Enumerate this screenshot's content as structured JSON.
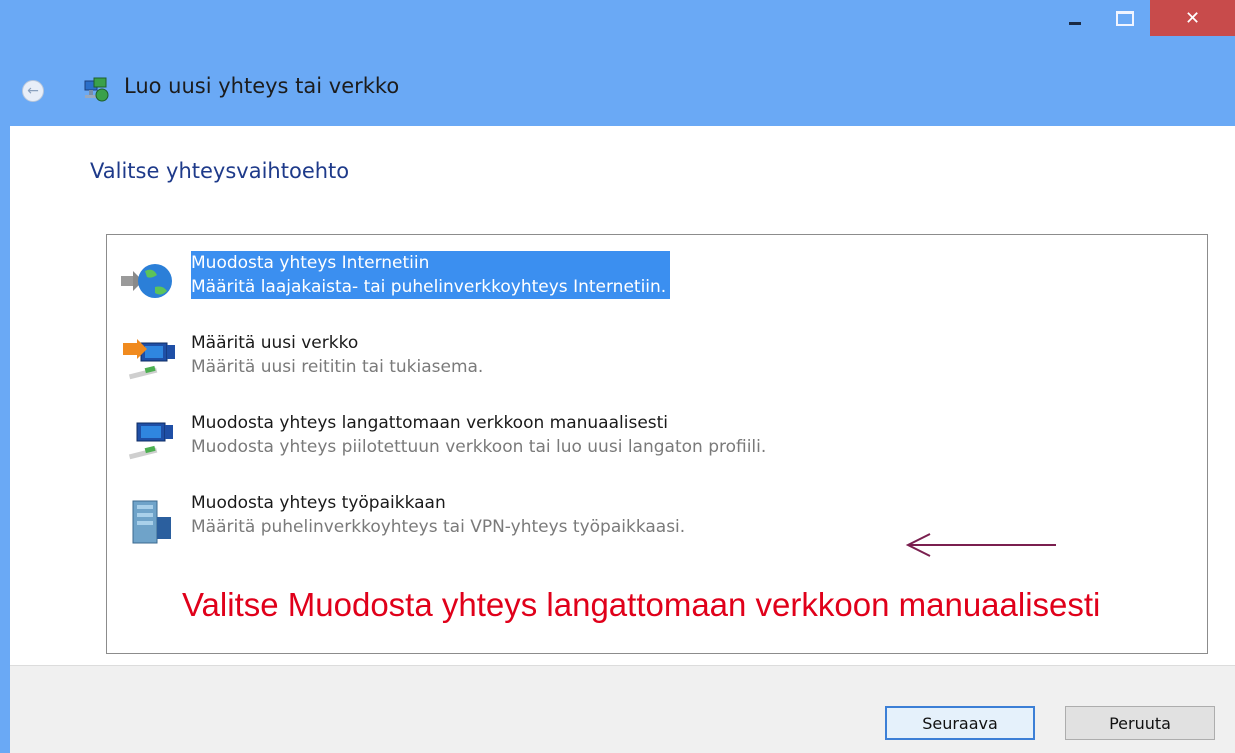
{
  "window": {
    "title": "Luo uusi yhteys tai verkko",
    "controls": {
      "minimize": "–",
      "maximize": "☐",
      "close": "✕"
    }
  },
  "header": {
    "back_icon": "arrow-left-icon",
    "app_icon": "network-globe-icon"
  },
  "main": {
    "instruction": "Valitse yhteysvaihtoehto",
    "options": [
      {
        "title": "Muodosta yhteys Internetiin",
        "desc": "Määritä laajakaista- tai puhelinverkkoyhteys Internetiin.",
        "icon": "internet-globe-icon",
        "selected": true
      },
      {
        "title": "Määritä uusi verkko",
        "desc": "Määritä uusi reititin tai tukiasema.",
        "icon": "new-network-icon",
        "selected": false
      },
      {
        "title": "Muodosta yhteys langattomaan verkkoon manuaalisesti",
        "desc": "Muodosta yhteys piilotettuun verkkoon tai luo uusi langaton profiili.",
        "icon": "wireless-network-icon",
        "selected": false
      },
      {
        "title": "Muodosta yhteys työpaikkaan",
        "desc": "Määritä puhelinverkkoyhteys tai VPN-yhteys työpaikkaasi.",
        "icon": "workplace-server-icon",
        "selected": false
      }
    ],
    "annotation": "Valitse Muodosta yhteys langattomaan verkkoon manuaalisesti"
  },
  "footer": {
    "next_label": "Seuraava",
    "cancel_label": "Peruuta"
  },
  "colors": {
    "titlebar": "#6aa9f5",
    "close": "#c84b4b",
    "selection": "#3b8ff0",
    "instruction": "#1e3a8a",
    "annotation": "#e0001a",
    "arrow": "#7a1f4f"
  }
}
